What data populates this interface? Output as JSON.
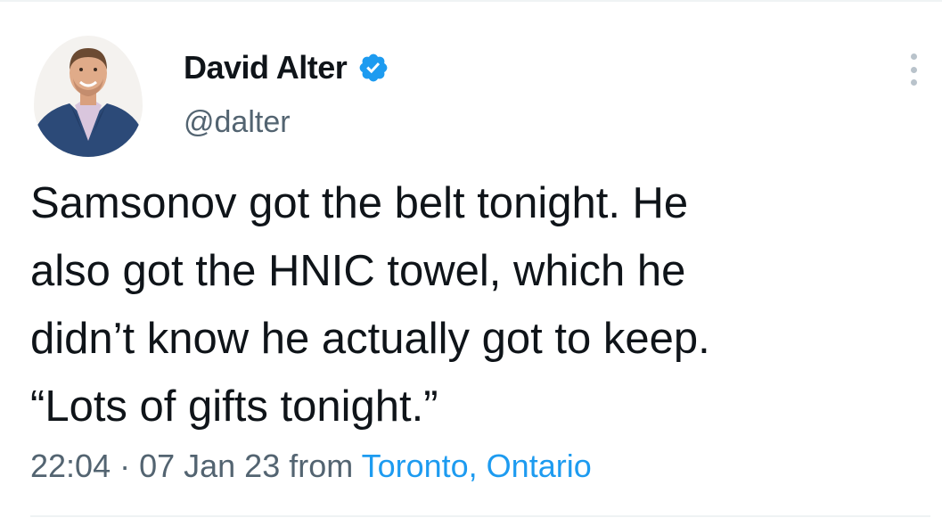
{
  "author": {
    "display_name": "David Alter",
    "handle": "@dalter",
    "verified": true,
    "verified_icon": "verified-badge-icon",
    "avatar_icon": "profile-photo"
  },
  "more_menu": {
    "icon": "more-vertical-icon"
  },
  "tweet": {
    "text_lines": [
      "Samsonov got the belt tonight. He",
      "also got the HNIC towel, which he",
      "didn’t know he actually got to keep.",
      "“Lots of gifts tonight.”"
    ]
  },
  "meta": {
    "time": "22:04",
    "separator": " · ",
    "date": "07 Jan 23",
    "from_label": " from ",
    "location": "Toronto, Ontario"
  },
  "colors": {
    "text": "#0f1419",
    "secondary": "#536471",
    "accent": "#1d9bf0",
    "divider": "#eff3f4"
  }
}
